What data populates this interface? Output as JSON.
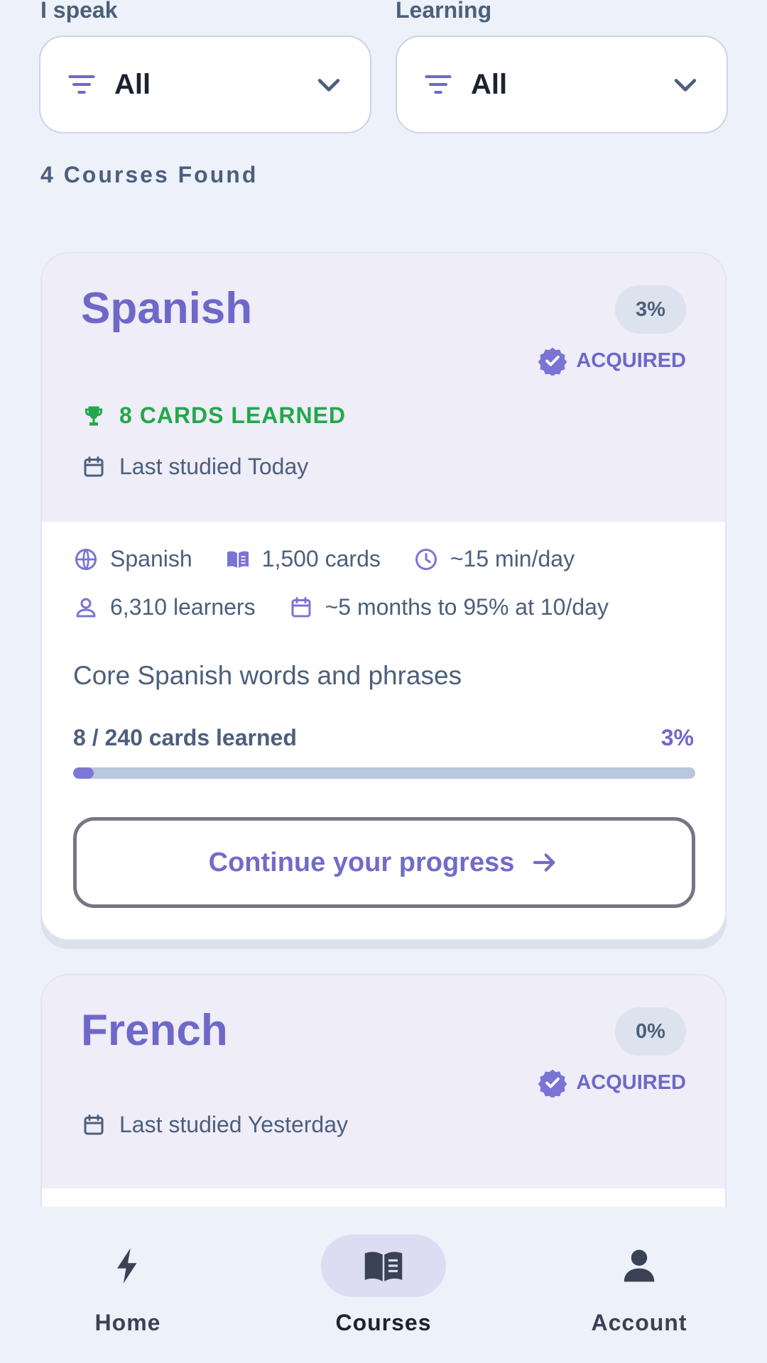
{
  "filters": {
    "speak": {
      "label": "I speak",
      "value": "All"
    },
    "learning": {
      "label": "Learning",
      "value": "All"
    }
  },
  "results": {
    "count_text": "4 Courses Found"
  },
  "courses": [
    {
      "title": "Spanish",
      "percent": "3%",
      "acquired": "ACQUIRED",
      "cards_learned_badge": "8 CARDS LEARNED",
      "last_studied": "Last studied Today",
      "meta": {
        "language": "Spanish",
        "cards": "1,500 cards",
        "time": "~15 min/day",
        "learners": "6,310 learners",
        "estimate": "~5 months to 95% at 10/day"
      },
      "description": "Core Spanish words and phrases",
      "progress_text": "8 / 240 cards learned",
      "progress_percent": "3%",
      "progress_fraction": 0.033,
      "cta": "Continue your progress"
    },
    {
      "title": "French",
      "percent": "0%",
      "acquired": "ACQUIRED",
      "last_studied": "Last studied Yesterday"
    }
  ],
  "nav": {
    "items": [
      {
        "label": "Home",
        "icon": "bolt-icon"
      },
      {
        "label": "Courses",
        "icon": "book-icon",
        "active": true
      },
      {
        "label": "Account",
        "icon": "person-icon"
      }
    ]
  },
  "colors": {
    "accent": "#6e68c9",
    "success": "#22a84a",
    "text": "#4c5f7c",
    "background": "#edf1fa"
  }
}
